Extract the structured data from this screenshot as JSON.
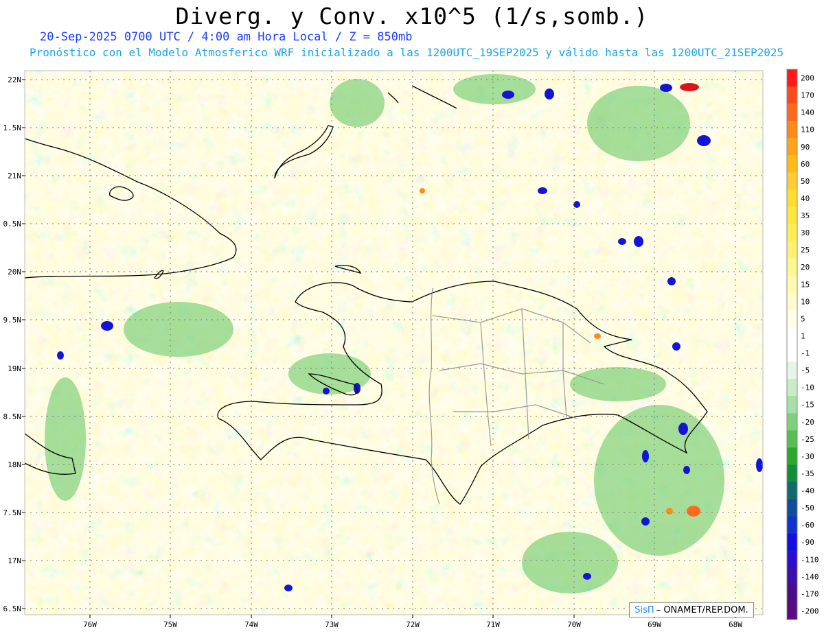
{
  "title": "Diverg. y Conv. x10^5 (1/s,somb.)",
  "subtitle_1": "20-Sep-2025  0700 UTC / 4:00 am Hora Local / Z = 850mb",
  "subtitle_2": "Pronóstico con el Modelo Atmosferico WRF inicializado a las 1200UTC_19SEP2025 y válido hasta las  1200UTC_21SEP2025",
  "footer": {
    "brand": "SisΠ",
    "text": "– ONAMET/REP.DOM."
  },
  "map": {
    "lat_labels": [
      "22N",
      "1.5N",
      "21N",
      "0.5N",
      "20N",
      "9.5N",
      "19N",
      "8.5N",
      "18N",
      "7.5N",
      "17N",
      "6.5N"
    ],
    "lon_labels": [
      "76W",
      "75W",
      "74W",
      "73W",
      "72W",
      "71W",
      "70W",
      "69W",
      "68W"
    ]
  },
  "colorbar": {
    "labels": [
      "200",
      "170",
      "140",
      "110",
      "90",
      "60",
      "50",
      "40",
      "35",
      "30",
      "25",
      "20",
      "15",
      "10",
      "5",
      "1",
      "-1",
      "-5",
      "-10",
      "-15",
      "-20",
      "-25",
      "-30",
      "-35",
      "-40",
      "-50",
      "-60",
      "-90",
      "-110",
      "-140",
      "-170",
      "-200"
    ],
    "colors": [
      "#ff1a1a",
      "#ff4a1a",
      "#ff6a1a",
      "#ff8a1a",
      "#ffa31a",
      "#ffbb1a",
      "#ffcc33",
      "#ffdd33",
      "#ffe640",
      "#ffee55",
      "#fff270",
      "#fff690",
      "#fffab0",
      "#fffccc",
      "#ffffe5",
      "#ffffff",
      "#ffffff",
      "#e6f5e6",
      "#c8ecc8",
      "#a6e0a6",
      "#7dd07d",
      "#55be55",
      "#2aa82a",
      "#0f8f3a",
      "#116b6b",
      "#114d99",
      "#0f33cc",
      "#1010e6",
      "#2a10cc",
      "#3c10aa",
      "#4a0e88",
      "#5a0a80"
    ]
  }
}
